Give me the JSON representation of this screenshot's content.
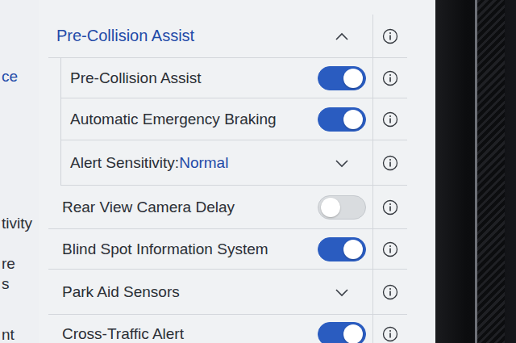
{
  "sidebar": {
    "items": [
      {
        "label": "ce",
        "selected": true
      },
      {
        "label": "tivity",
        "selected": false
      },
      {
        "label": "re",
        "selected": false
      },
      {
        "label": "s",
        "selected": false
      },
      {
        "label": "nt",
        "selected": false
      }
    ]
  },
  "section": {
    "title": "Pre-Collision Assist",
    "expanded": true,
    "items": [
      {
        "kind": "toggle",
        "label": "Pre-Collision Assist",
        "on": true
      },
      {
        "kind": "toggle",
        "label": "Automatic Emergency Braking",
        "on": true
      },
      {
        "kind": "dropdown",
        "label": "Alert Sensitivity:",
        "value": "Normal",
        "expanded": false
      }
    ]
  },
  "rows": [
    {
      "kind": "toggle",
      "label": "Rear View Camera Delay",
      "on": false
    },
    {
      "kind": "toggle",
      "label": "Blind Spot Information System",
      "on": true
    },
    {
      "kind": "dropdown",
      "label": "Park Aid Sensors",
      "expanded": false
    },
    {
      "kind": "toggle",
      "label": "Cross-Traffic Alert",
      "on": true
    }
  ]
}
